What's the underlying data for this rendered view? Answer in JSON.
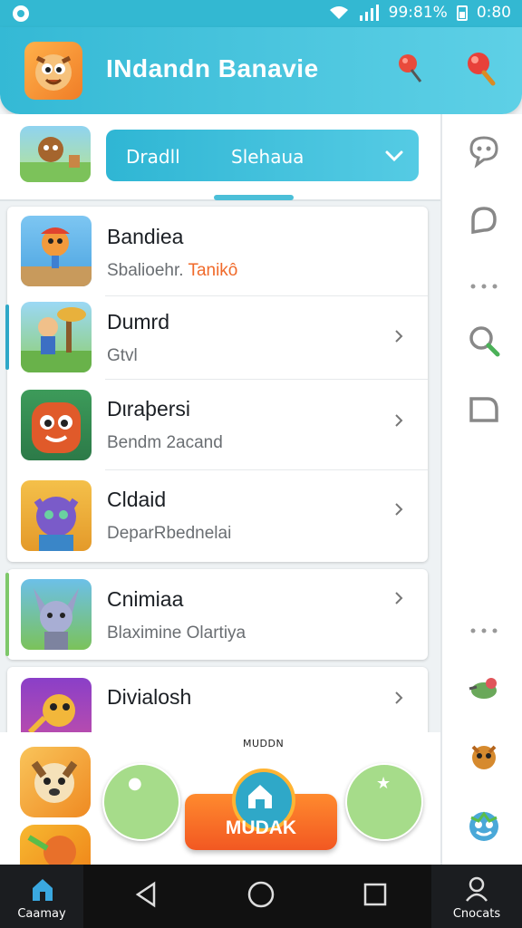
{
  "status_bar": {
    "battery": "99:81%",
    "time": "0:80"
  },
  "header": {
    "title": "INdandn Banavie"
  },
  "filter": {
    "label": "Dradll",
    "value": "Slehaua"
  },
  "list": [
    {
      "title": "Bandiea",
      "subtitle": "Sbalioehr.",
      "subtitle_accent": "Tanikô",
      "has_arrow": false
    },
    {
      "title": "Dumrd",
      "subtitle": "Gtvl",
      "has_arrow": true
    },
    {
      "title": "Dιraþersi",
      "subtitle": "Bendm 2acand",
      "has_arrow": true
    },
    {
      "title": "Cldaid",
      "subtitle": "DeparRbednelai",
      "has_arrow": true
    },
    {
      "title": "Cnimiaa",
      "subtitle": "Blaximine Olartiya",
      "has_arrow": true
    },
    {
      "title": "Divialosh",
      "subtitle": "",
      "has_arrow": true
    }
  ],
  "bottom": {
    "small_label": "MUDDN",
    "main_button": "MUDAK"
  },
  "nav": {
    "left_label": "Caamay",
    "right_label": "Cnocats"
  },
  "colors": {
    "primary": "#34b9d5",
    "accent": "#f25822",
    "green": "#a6dc8a"
  }
}
